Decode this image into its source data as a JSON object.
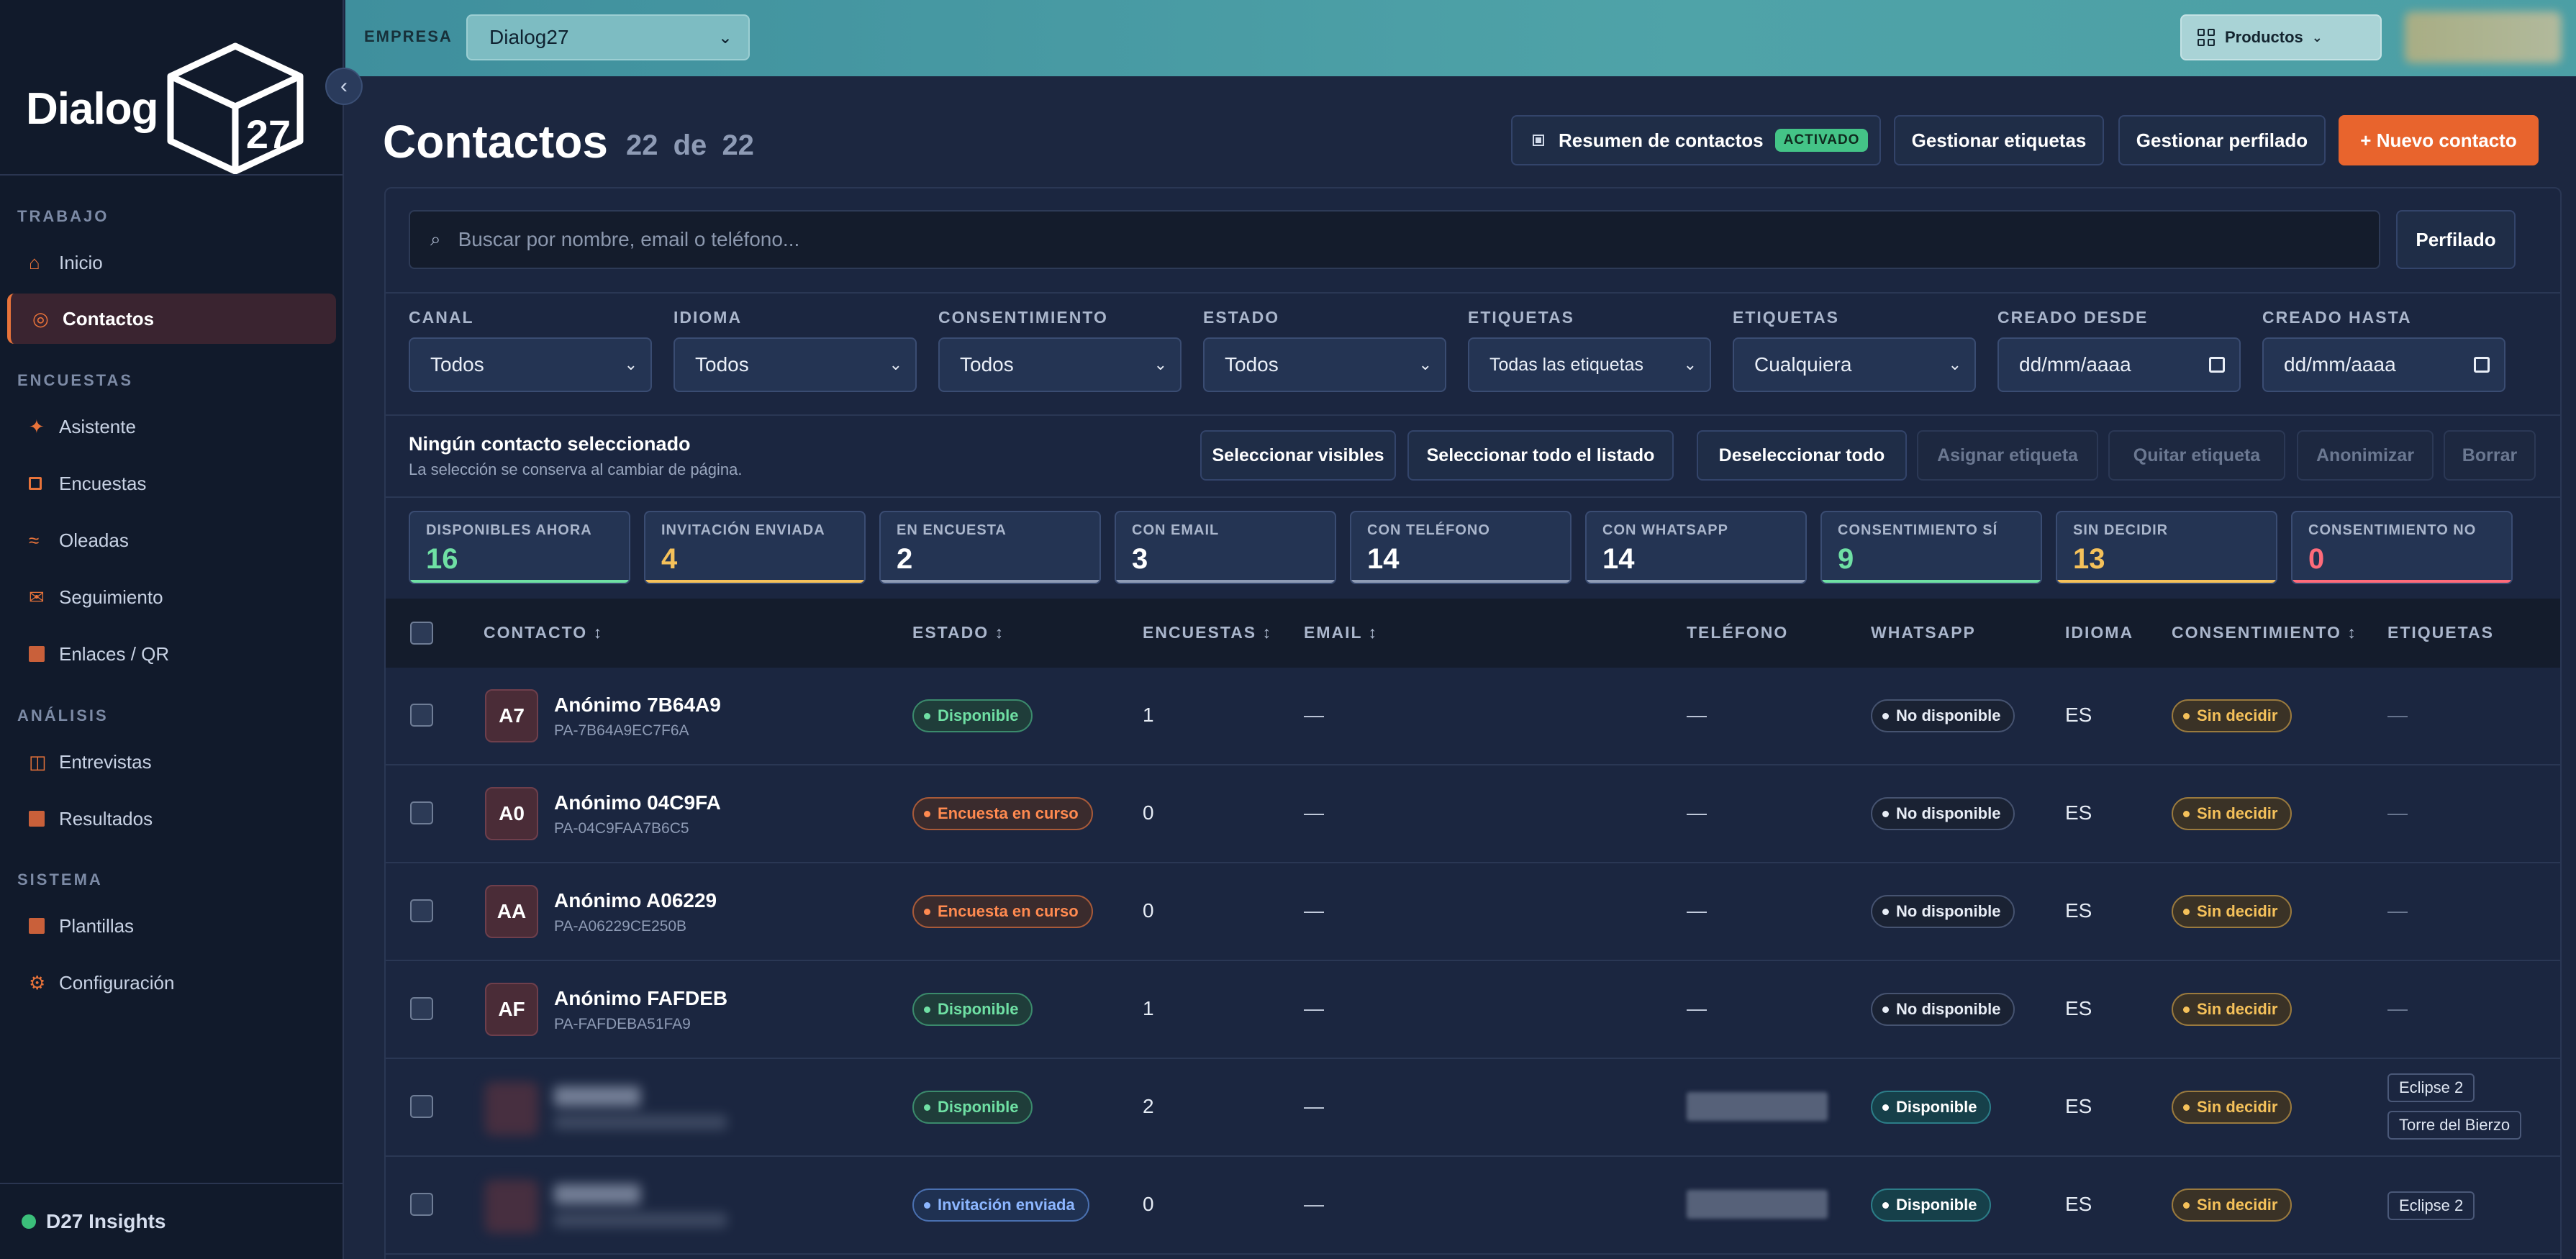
{
  "app": {
    "brand": "Dialog",
    "brand_number": "27",
    "footer_brand": "D27 Insights"
  },
  "sidebar": {
    "sections": [
      {
        "label": "TRABAJO",
        "items": [
          {
            "label": "Inicio",
            "icon": "home-icon",
            "active": false
          },
          {
            "label": "Contactos",
            "icon": "target-icon",
            "active": true
          }
        ]
      },
      {
        "label": "ENCUESTAS",
        "items": [
          {
            "label": "Asistente",
            "icon": "sparkle-icon",
            "active": false
          },
          {
            "label": "Encuestas",
            "icon": "square-outline-icon",
            "active": false
          },
          {
            "label": "Oleadas",
            "icon": "waves-icon",
            "active": false
          },
          {
            "label": "Seguimiento",
            "icon": "mail-icon",
            "active": false
          },
          {
            "label": "Enlaces / QR",
            "icon": "square-icon",
            "active": false
          }
        ]
      },
      {
        "label": "ANÁLISIS",
        "items": [
          {
            "label": "Entrevistas",
            "icon": "columns-icon",
            "active": false
          },
          {
            "label": "Resultados",
            "icon": "square-icon",
            "active": false
          }
        ]
      },
      {
        "label": "SISTEMA",
        "items": [
          {
            "label": "Plantillas",
            "icon": "square-icon",
            "active": false
          },
          {
            "label": "Configuración",
            "icon": "gear-icon",
            "active": false
          }
        ]
      }
    ]
  },
  "topbar": {
    "empresa_label": "EMPRESA",
    "empresa_value": "Dialog27",
    "productos_label": "Productos"
  },
  "header": {
    "title": "Contactos",
    "count_shown": "22",
    "count_sep": "de",
    "count_total": "22",
    "resumen_label": "Resumen de contactos",
    "resumen_badge": "ACTIVADO",
    "etiquetas_button": "Gestionar etiquetas",
    "perfilado_button": "Gestionar perfilado",
    "nuevo_button": "+  Nuevo contacto"
  },
  "search": {
    "placeholder": "Buscar por nombre, email o teléfono...",
    "perfilado_button": "Perfilado"
  },
  "filters": [
    {
      "label": "CANAL",
      "value": "Todos",
      "kind": "select"
    },
    {
      "label": "IDIOMA",
      "value": "Todos",
      "kind": "select"
    },
    {
      "label": "CONSENTIMIENTO",
      "value": "Todos",
      "kind": "select"
    },
    {
      "label": "ESTADO",
      "value": "Todos",
      "kind": "select"
    },
    {
      "label": "ETIQUETAS",
      "value": "Todas las etiquetas",
      "kind": "select-small"
    },
    {
      "label": "ETIQUETAS",
      "value": "Cualquiera",
      "kind": "select"
    },
    {
      "label": "CREADO DESDE",
      "value": "dd/mm/aaaa",
      "kind": "date"
    },
    {
      "label": "CREADO HASTA",
      "value": "dd/mm/aaaa",
      "kind": "date"
    }
  ],
  "selection": {
    "title": "Ningún contacto seleccionado",
    "subtitle": "La selección se conserva al cambiar de página.",
    "buttons": [
      {
        "label": "Seleccionar visibles",
        "enabled": true
      },
      {
        "label": "Seleccionar todo el listado",
        "enabled": true
      },
      {
        "label": "Deseleccionar todo",
        "enabled": true
      },
      {
        "label": "Asignar etiqueta",
        "enabled": false
      },
      {
        "label": "Quitar etiqueta",
        "enabled": false
      },
      {
        "label": "Anonimizar",
        "enabled": false
      },
      {
        "label": "Borrar",
        "enabled": false
      }
    ]
  },
  "stats": [
    {
      "label": "DISPONIBLES AHORA",
      "value": "16",
      "color": "#6fe0a4"
    },
    {
      "label": "INVITACIÓN ENVIADA",
      "value": "4",
      "color": "#f5c15a"
    },
    {
      "label": "EN ENCUESTA",
      "value": "2",
      "color": "#ffffff"
    },
    {
      "label": "CON EMAIL",
      "value": "3",
      "color": "#ffffff"
    },
    {
      "label": "CON TELÉFONO",
      "value": "14",
      "color": "#ffffff"
    },
    {
      "label": "CON WHATSAPP",
      "value": "14",
      "color": "#ffffff"
    },
    {
      "label": "CONSENTIMIENTO SÍ",
      "value": "9",
      "color": "#6fe0a4"
    },
    {
      "label": "SIN DECIDIR",
      "value": "13",
      "color": "#f5c15a"
    },
    {
      "label": "CONSENTIMIENTO NO",
      "value": "0",
      "color": "#ff6b7a"
    }
  ],
  "table": {
    "columns": [
      "CONTACTO ↕",
      "ESTADO ↕",
      "ENCUESTAS ↕",
      "EMAIL ↕",
      "TELÉFONO",
      "WHATSAPP",
      "IDIOMA",
      "CONSENTIMIENTO ↕",
      "ETIQUETAS"
    ],
    "rows": [
      {
        "initials": "A7",
        "name": "Anónimo 7B64A9",
        "id": "PA-7B64A9EC7F6A",
        "blurred": false,
        "estado": "Disponible",
        "estado_style": "green",
        "encuestas": "1",
        "email": "—",
        "telefono": "—",
        "phone_blurred": false,
        "whatsapp": "No disponible",
        "whatsapp_style": "gray",
        "idioma": "ES",
        "consentimiento": "Sin decidir",
        "etiquetas": [],
        "etiquetas_empty": "—"
      },
      {
        "initials": "A0",
        "name": "Anónimo 04C9FA",
        "id": "PA-04C9FAA7B6C5",
        "blurred": false,
        "estado": "Encuesta en curso",
        "estado_style": "orange",
        "encuestas": "0",
        "email": "—",
        "telefono": "—",
        "phone_blurred": false,
        "whatsapp": "No disponible",
        "whatsapp_style": "gray",
        "idioma": "ES",
        "consentimiento": "Sin decidir",
        "etiquetas": [],
        "etiquetas_empty": "—"
      },
      {
        "initials": "AA",
        "name": "Anónimo A06229",
        "id": "PA-A06229CE250B",
        "blurred": false,
        "estado": "Encuesta en curso",
        "estado_style": "orange",
        "encuestas": "0",
        "email": "—",
        "telefono": "—",
        "phone_blurred": false,
        "whatsapp": "No disponible",
        "whatsapp_style": "gray",
        "idioma": "ES",
        "consentimiento": "Sin decidir",
        "etiquetas": [],
        "etiquetas_empty": "—"
      },
      {
        "initials": "AF",
        "name": "Anónimo FAFDEB",
        "id": "PA-FAFDEBA51FA9",
        "blurred": false,
        "estado": "Disponible",
        "estado_style": "green",
        "encuestas": "1",
        "email": "—",
        "telefono": "—",
        "phone_blurred": false,
        "whatsapp": "No disponible",
        "whatsapp_style": "gray",
        "idioma": "ES",
        "consentimiento": "Sin decidir",
        "etiquetas": [],
        "etiquetas_empty": "—"
      },
      {
        "initials": "",
        "name": "",
        "id": "",
        "blurred": true,
        "estado": "Disponible",
        "estado_style": "green",
        "encuestas": "2",
        "email": "—",
        "telefono": "",
        "phone_blurred": true,
        "whatsapp": "Disponible",
        "whatsapp_style": "teal",
        "idioma": "ES",
        "consentimiento": "Sin decidir",
        "etiquetas": [
          "Eclipse 2",
          "Torre del Bierzo"
        ],
        "etiquetas_empty": ""
      },
      {
        "initials": "",
        "name": "",
        "id": "",
        "blurred": true,
        "estado": "Invitación enviada",
        "estado_style": "blue",
        "encuestas": "0",
        "email": "—",
        "telefono": "",
        "phone_blurred": true,
        "whatsapp": "Disponible",
        "whatsapp_style": "teal",
        "idioma": "ES",
        "consentimiento": "Sin decidir",
        "etiquetas": [
          "Eclipse 2"
        ],
        "etiquetas_empty": ""
      }
    ]
  }
}
